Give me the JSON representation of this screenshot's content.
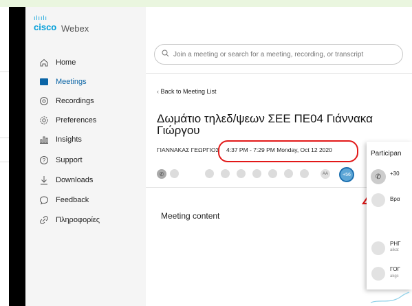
{
  "app": {
    "logo_cisco": "cisco",
    "logo_bars": "ılıılı",
    "logo_webex": "Webex"
  },
  "sidebar": {
    "items": [
      {
        "label": "Home",
        "icon": "home-icon"
      },
      {
        "label": "Meetings",
        "icon": "meetings-icon"
      },
      {
        "label": "Recordings",
        "icon": "record-icon"
      },
      {
        "label": "Preferences",
        "icon": "gear-icon"
      },
      {
        "label": "Insights",
        "icon": "chart-icon"
      },
      {
        "label": "Support",
        "icon": "help-icon"
      },
      {
        "label": "Downloads",
        "icon": "download-icon"
      },
      {
        "label": "Feedback",
        "icon": "chat-icon"
      },
      {
        "label": "Πληροφορίες",
        "icon": "link-icon"
      }
    ]
  },
  "search": {
    "placeholder": "Join a meeting or search for a meeting, recording, or transcript"
  },
  "meeting": {
    "back": "Back to Meeting List",
    "title": "Δωμάτιο τηλεδ/ψεων ΣΕΕ ΠΕ04 Γιάννακα Γιώργου",
    "host": "ΓΙΑΝΝΑΚΑΣ ΓΕΩΡΓΙΟΣ",
    "time": "4:37 PM - 7:29 PM  Monday, Oct 12 2020",
    "aa": "AA",
    "more_count": "+56",
    "content_label": "Meeting content"
  },
  "participants": {
    "title": "Participan",
    "phone": "+30",
    "items": [
      {
        "name": "Βρα",
        "sub": ""
      },
      {
        "name": "ΡΗΓ",
        "sub": "aikat"
      },
      {
        "name": "ΓΟΓ",
        "sub": "akgc"
      }
    ]
  },
  "colors": {
    "accent": "#0b65a6",
    "highlight": "#e21818",
    "background": "#eaf6df"
  }
}
